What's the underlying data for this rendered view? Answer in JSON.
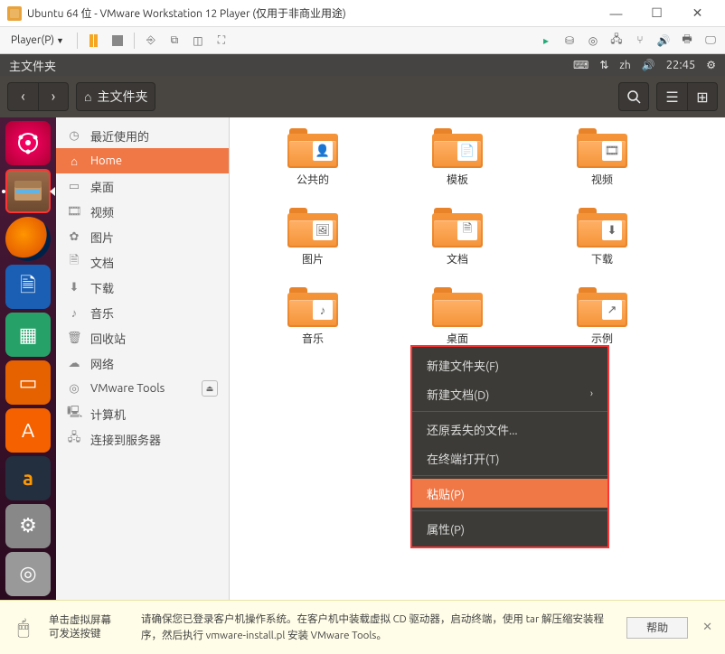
{
  "vmware": {
    "title": "Ubuntu 64 位 - VMware Workstation 12 Player (仅用于非商业用途)",
    "player_menu": "Player(P)",
    "hint_left": "单击虚拟屏幕\n可发送按键",
    "hint_main": "请确保您已登录客户机操作系统。在客户机中装载虚拟 CD 驱动器，启动终端，使用 tar 解压缩安装程序，然后执行 vmware-install.pl 安装 VMware Tools。",
    "help_btn": "帮助"
  },
  "ubuntu": {
    "menubar_title": "主文件夹",
    "time": "22:45",
    "lang": "zh"
  },
  "nautilus": {
    "path_label": "主文件夹",
    "sidebar": [
      {
        "icon": "◷",
        "label": "最近使用的",
        "key": "recent"
      },
      {
        "icon": "⌂",
        "label": "Home",
        "key": "home",
        "active": true
      },
      {
        "icon": "▭",
        "label": "桌面",
        "key": "desktop"
      },
      {
        "icon": "🎞",
        "label": "视频",
        "key": "videos"
      },
      {
        "icon": "✿",
        "label": "图片",
        "key": "pictures"
      },
      {
        "icon": "🗎",
        "label": "文档",
        "key": "documents"
      },
      {
        "icon": "⬇",
        "label": "下载",
        "key": "downloads"
      },
      {
        "icon": "♪",
        "label": "音乐",
        "key": "music"
      },
      {
        "icon": "🗑",
        "label": "回收站",
        "key": "trash"
      },
      {
        "icon": "☁",
        "label": "网络",
        "key": "network"
      },
      {
        "icon": "◎",
        "label": "VMware Tools",
        "key": "vmtools",
        "eject": true
      },
      {
        "icon": "🖳",
        "label": "计算机",
        "key": "computer"
      },
      {
        "icon": "🖧",
        "label": "连接到服务器",
        "key": "connect"
      }
    ],
    "folders": [
      {
        "label": "公共的",
        "emblem": "👤"
      },
      {
        "label": "模板",
        "emblem": "📄"
      },
      {
        "label": "视频",
        "emblem": "🎞"
      },
      {
        "label": "图片",
        "emblem": "🖼"
      },
      {
        "label": "文档",
        "emblem": "🗎"
      },
      {
        "label": "下载",
        "emblem": "⬇"
      },
      {
        "label": "音乐",
        "emblem": "♪"
      },
      {
        "label": "桌面",
        "emblem": ""
      },
      {
        "label": "示例",
        "emblem": "↗"
      }
    ],
    "context_menu": [
      {
        "label": "新建文件夹(F)"
      },
      {
        "label": "新建文档(D)",
        "submenu": true
      },
      {
        "sep": true
      },
      {
        "label": "还原丢失的文件..."
      },
      {
        "label": "在终端打开(T)"
      },
      {
        "sep": true
      },
      {
        "label": "粘贴(P)",
        "active": true
      },
      {
        "sep": true
      },
      {
        "label": "属性(P)"
      }
    ]
  }
}
